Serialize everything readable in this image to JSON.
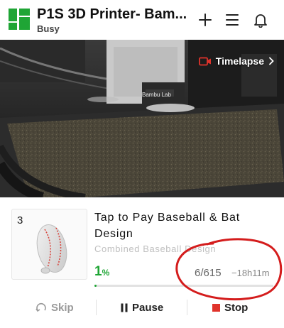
{
  "header": {
    "title": "P1S 3D Printer- Bam...",
    "status": "Busy"
  },
  "camera": {
    "brand_plate": "Bambu Lab",
    "timelapse_label": "Timelapse"
  },
  "job": {
    "plate_number": "3",
    "title": "Tap to Pay Baseball & Bat Design",
    "subtitle": "Combined Baseball Design",
    "percent": "1",
    "percent_unit": "%",
    "progress_fraction": 0.01,
    "layers": "6/615",
    "remaining": "−18h11m"
  },
  "actions": {
    "skip_label": "Skip",
    "pause_label": "Pause",
    "stop_label": "Stop"
  },
  "colors": {
    "accent_green": "#1fa535",
    "stop_red": "#e0332b",
    "annotation_red": "#d41c1c"
  }
}
